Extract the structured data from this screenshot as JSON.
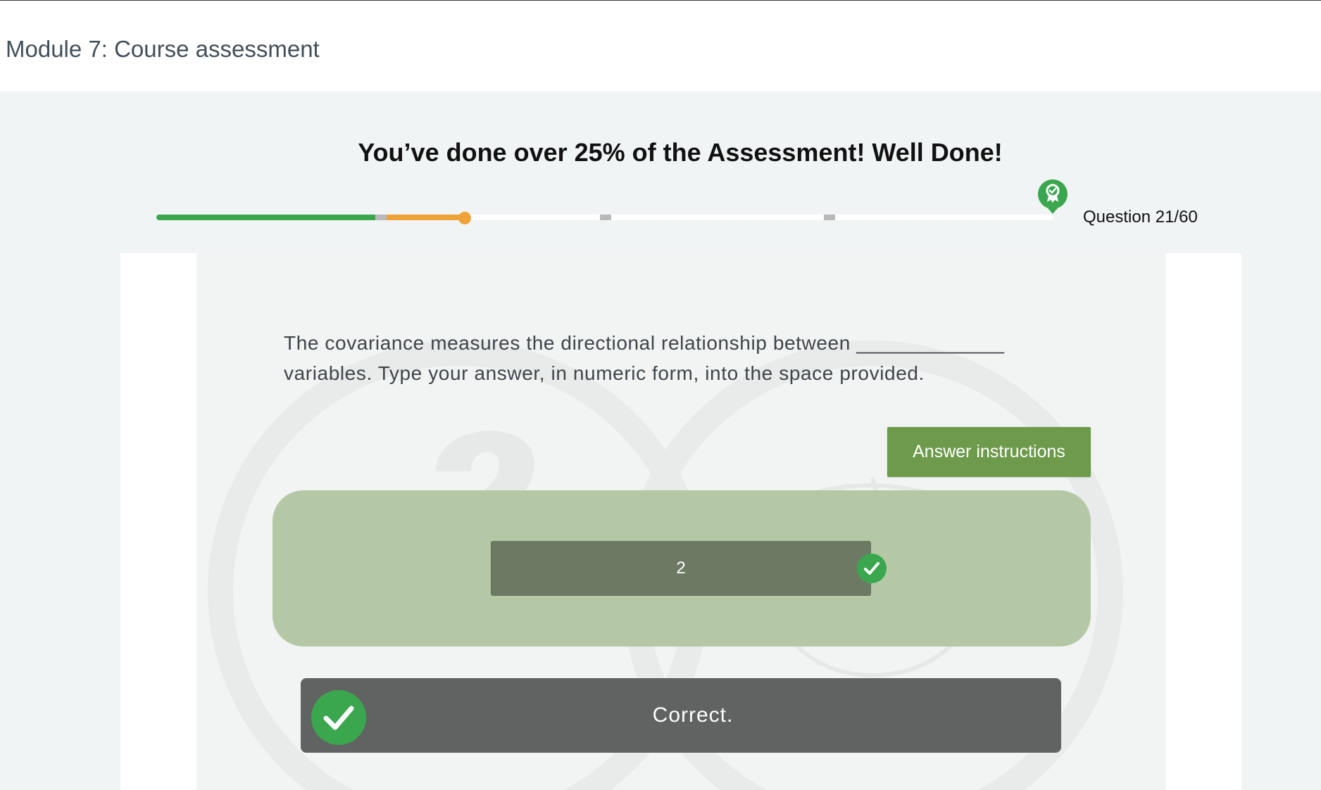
{
  "header": {
    "module_title": "Module 7: Course assessment"
  },
  "banner": {
    "message": "You’ve done over 25% of the Assessment! Well Done!"
  },
  "progress": {
    "question_counter": "Question 21/60",
    "completed_fraction": 0.25,
    "current_fraction": 0.35,
    "colors": {
      "done": "#3aa74e",
      "current": "#f0a23a",
      "remaining": "#ffffff",
      "milestone": "#b9b9b9"
    },
    "end_badge_icon": "award-ribbon-icon"
  },
  "question": {
    "text": "The covariance measures the directional relationship between _____________ variables. Type your answer, in numeric form, into the space provided."
  },
  "answer_instructions_button": {
    "label": "Answer instructions",
    "color": "#6e9a4b"
  },
  "answer": {
    "value": "2",
    "status_icon": "check-circle-icon"
  },
  "feedback": {
    "message": "Correct.",
    "icon": "check-circle-icon",
    "accent": "#3aa74e"
  }
}
